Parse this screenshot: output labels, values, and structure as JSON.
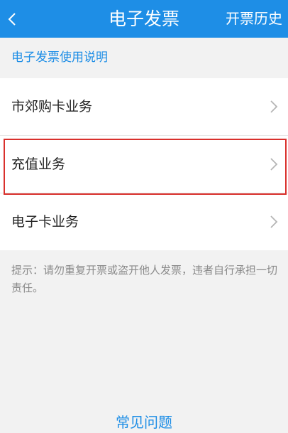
{
  "header": {
    "back_icon": "chevron-left-icon",
    "title": "电子发票",
    "history_label": "开票历史",
    "background": "#1e8ee6"
  },
  "instructions": {
    "label": "电子发票使用说明"
  },
  "list": {
    "items": [
      {
        "label": "市郊购卡业务",
        "icon": "chevron-right-icon"
      },
      {
        "label": "充值业务",
        "icon": "chevron-right-icon",
        "highlighted": true
      },
      {
        "label": "电子卡业务",
        "icon": "chevron-right-icon"
      }
    ]
  },
  "tip": {
    "text": "提示：请勿重复开票或盗开他人发票，违者自行承担一切责任。"
  },
  "footer": {
    "faq_label": "常见问题"
  },
  "colors": {
    "accent": "#1e8ee6",
    "highlight": "#d9302c",
    "background": "#f2f2f2"
  }
}
